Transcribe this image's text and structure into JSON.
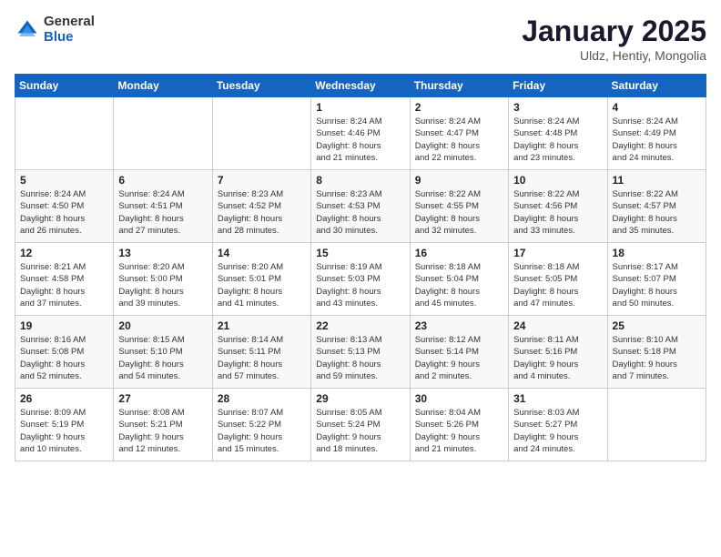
{
  "logo": {
    "general": "General",
    "blue": "Blue"
  },
  "header": {
    "month": "January 2025",
    "location": "Uldz, Hentiy, Mongolia"
  },
  "weekdays": [
    "Sunday",
    "Monday",
    "Tuesday",
    "Wednesday",
    "Thursday",
    "Friday",
    "Saturday"
  ],
  "weeks": [
    [
      {
        "day": "",
        "info": ""
      },
      {
        "day": "",
        "info": ""
      },
      {
        "day": "",
        "info": ""
      },
      {
        "day": "1",
        "info": "Sunrise: 8:24 AM\nSunset: 4:46 PM\nDaylight: 8 hours\nand 21 minutes."
      },
      {
        "day": "2",
        "info": "Sunrise: 8:24 AM\nSunset: 4:47 PM\nDaylight: 8 hours\nand 22 minutes."
      },
      {
        "day": "3",
        "info": "Sunrise: 8:24 AM\nSunset: 4:48 PM\nDaylight: 8 hours\nand 23 minutes."
      },
      {
        "day": "4",
        "info": "Sunrise: 8:24 AM\nSunset: 4:49 PM\nDaylight: 8 hours\nand 24 minutes."
      }
    ],
    [
      {
        "day": "5",
        "info": "Sunrise: 8:24 AM\nSunset: 4:50 PM\nDaylight: 8 hours\nand 26 minutes."
      },
      {
        "day": "6",
        "info": "Sunrise: 8:24 AM\nSunset: 4:51 PM\nDaylight: 8 hours\nand 27 minutes."
      },
      {
        "day": "7",
        "info": "Sunrise: 8:23 AM\nSunset: 4:52 PM\nDaylight: 8 hours\nand 28 minutes."
      },
      {
        "day": "8",
        "info": "Sunrise: 8:23 AM\nSunset: 4:53 PM\nDaylight: 8 hours\nand 30 minutes."
      },
      {
        "day": "9",
        "info": "Sunrise: 8:22 AM\nSunset: 4:55 PM\nDaylight: 8 hours\nand 32 minutes."
      },
      {
        "day": "10",
        "info": "Sunrise: 8:22 AM\nSunset: 4:56 PM\nDaylight: 8 hours\nand 33 minutes."
      },
      {
        "day": "11",
        "info": "Sunrise: 8:22 AM\nSunset: 4:57 PM\nDaylight: 8 hours\nand 35 minutes."
      }
    ],
    [
      {
        "day": "12",
        "info": "Sunrise: 8:21 AM\nSunset: 4:58 PM\nDaylight: 8 hours\nand 37 minutes."
      },
      {
        "day": "13",
        "info": "Sunrise: 8:20 AM\nSunset: 5:00 PM\nDaylight: 8 hours\nand 39 minutes."
      },
      {
        "day": "14",
        "info": "Sunrise: 8:20 AM\nSunset: 5:01 PM\nDaylight: 8 hours\nand 41 minutes."
      },
      {
        "day": "15",
        "info": "Sunrise: 8:19 AM\nSunset: 5:03 PM\nDaylight: 8 hours\nand 43 minutes."
      },
      {
        "day": "16",
        "info": "Sunrise: 8:18 AM\nSunset: 5:04 PM\nDaylight: 8 hours\nand 45 minutes."
      },
      {
        "day": "17",
        "info": "Sunrise: 8:18 AM\nSunset: 5:05 PM\nDaylight: 8 hours\nand 47 minutes."
      },
      {
        "day": "18",
        "info": "Sunrise: 8:17 AM\nSunset: 5:07 PM\nDaylight: 8 hours\nand 50 minutes."
      }
    ],
    [
      {
        "day": "19",
        "info": "Sunrise: 8:16 AM\nSunset: 5:08 PM\nDaylight: 8 hours\nand 52 minutes."
      },
      {
        "day": "20",
        "info": "Sunrise: 8:15 AM\nSunset: 5:10 PM\nDaylight: 8 hours\nand 54 minutes."
      },
      {
        "day": "21",
        "info": "Sunrise: 8:14 AM\nSunset: 5:11 PM\nDaylight: 8 hours\nand 57 minutes."
      },
      {
        "day": "22",
        "info": "Sunrise: 8:13 AM\nSunset: 5:13 PM\nDaylight: 8 hours\nand 59 minutes."
      },
      {
        "day": "23",
        "info": "Sunrise: 8:12 AM\nSunset: 5:14 PM\nDaylight: 9 hours\nand 2 minutes."
      },
      {
        "day": "24",
        "info": "Sunrise: 8:11 AM\nSunset: 5:16 PM\nDaylight: 9 hours\nand 4 minutes."
      },
      {
        "day": "25",
        "info": "Sunrise: 8:10 AM\nSunset: 5:18 PM\nDaylight: 9 hours\nand 7 minutes."
      }
    ],
    [
      {
        "day": "26",
        "info": "Sunrise: 8:09 AM\nSunset: 5:19 PM\nDaylight: 9 hours\nand 10 minutes."
      },
      {
        "day": "27",
        "info": "Sunrise: 8:08 AM\nSunset: 5:21 PM\nDaylight: 9 hours\nand 12 minutes."
      },
      {
        "day": "28",
        "info": "Sunrise: 8:07 AM\nSunset: 5:22 PM\nDaylight: 9 hours\nand 15 minutes."
      },
      {
        "day": "29",
        "info": "Sunrise: 8:05 AM\nSunset: 5:24 PM\nDaylight: 9 hours\nand 18 minutes."
      },
      {
        "day": "30",
        "info": "Sunrise: 8:04 AM\nSunset: 5:26 PM\nDaylight: 9 hours\nand 21 minutes."
      },
      {
        "day": "31",
        "info": "Sunrise: 8:03 AM\nSunset: 5:27 PM\nDaylight: 9 hours\nand 24 minutes."
      },
      {
        "day": "",
        "info": ""
      }
    ]
  ]
}
